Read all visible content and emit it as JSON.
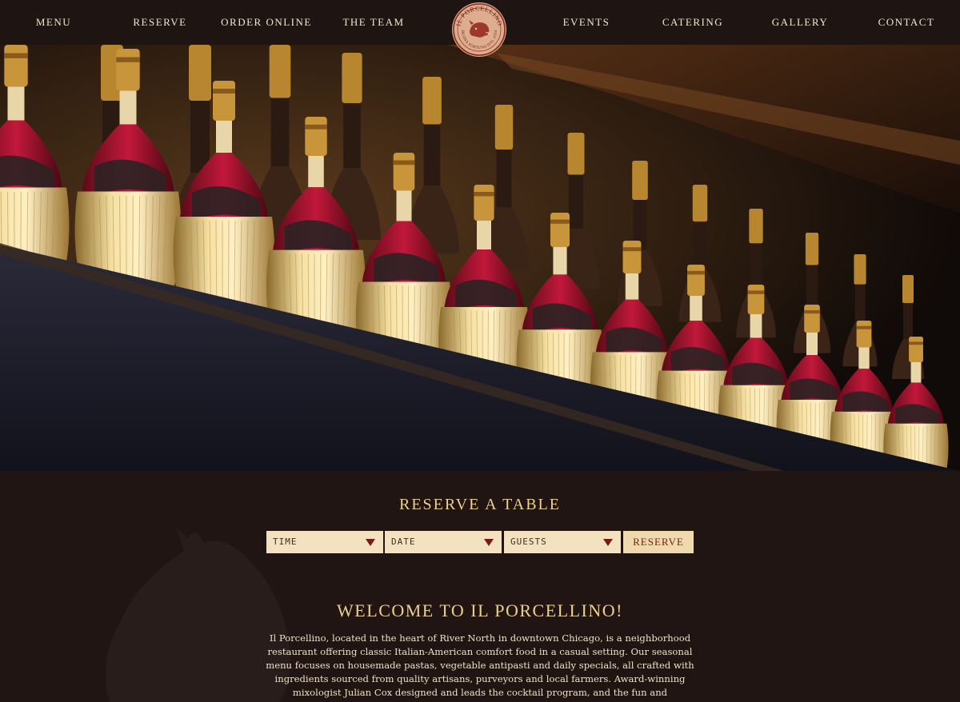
{
  "nav": {
    "left": [
      "MENU",
      "RESERVE",
      "ORDER ONLINE",
      "THE TEAM"
    ],
    "right": [
      "EVENTS",
      "CATERING",
      "GALLERY",
      "CONTACT"
    ]
  },
  "logo": {
    "name": "IL PORCELLINO",
    "motto": "BUONA FORTUNA DAL 1634"
  },
  "hero": {
    "image": "illuminated chianti fiasco bottles on a shelf"
  },
  "reserve": {
    "title": "RESERVE A TABLE",
    "time_label": "TIME",
    "date_label": "DATE",
    "guests_label": "GUESTS",
    "button": "RESERVE"
  },
  "welcome": {
    "title": "WELCOME TO IL PORCELLINO!",
    "body": "Il Porcellino, located in the heart of River North in downtown Chicago, is a neighborhood restaurant offering classic Italian-American comfort food in a casual setting. Our seasonal menu focuses on housemade pastas, vegetable antipasti and daily specials, all crafted with ingredients sourced from quality artisans, purveyors and local farmers. Award-winning mixologist Julian Cox designed and leads the cocktail program, and the fun and approachable wine program encourages sharing with"
  },
  "colors": {
    "background": "#211614",
    "gold_heading": "#ecd08f",
    "cream": "#f2e2bf",
    "accent_red": "#7a1b14"
  }
}
